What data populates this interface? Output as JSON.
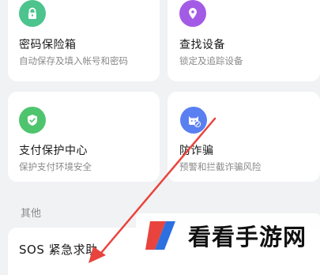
{
  "cards": [
    {
      "title": "密码保险箱",
      "subtitle": "自动保存及填入帐号和密码",
      "icon": "lock-icon",
      "color": "#4dc48d"
    },
    {
      "title": "查找设备",
      "subtitle": "锁定及追踪设备",
      "icon": "location-pin-icon",
      "color": "#a35be6"
    },
    {
      "title": "支付保护中心",
      "subtitle": "保护支付环境安全",
      "icon": "shield-check-icon",
      "color": "#4fc46e"
    },
    {
      "title": "防诈骗",
      "subtitle": "预警和拦截诈骗风险",
      "icon": "anti-fraud-icon",
      "color": "#5a7ff0"
    }
  ],
  "section": {
    "other_label": "其他"
  },
  "sos": {
    "title": "SOS 紧急求助"
  },
  "watermark": {
    "text": "看看手游网"
  },
  "annotation": {
    "arrow_color": "#e8443d"
  }
}
